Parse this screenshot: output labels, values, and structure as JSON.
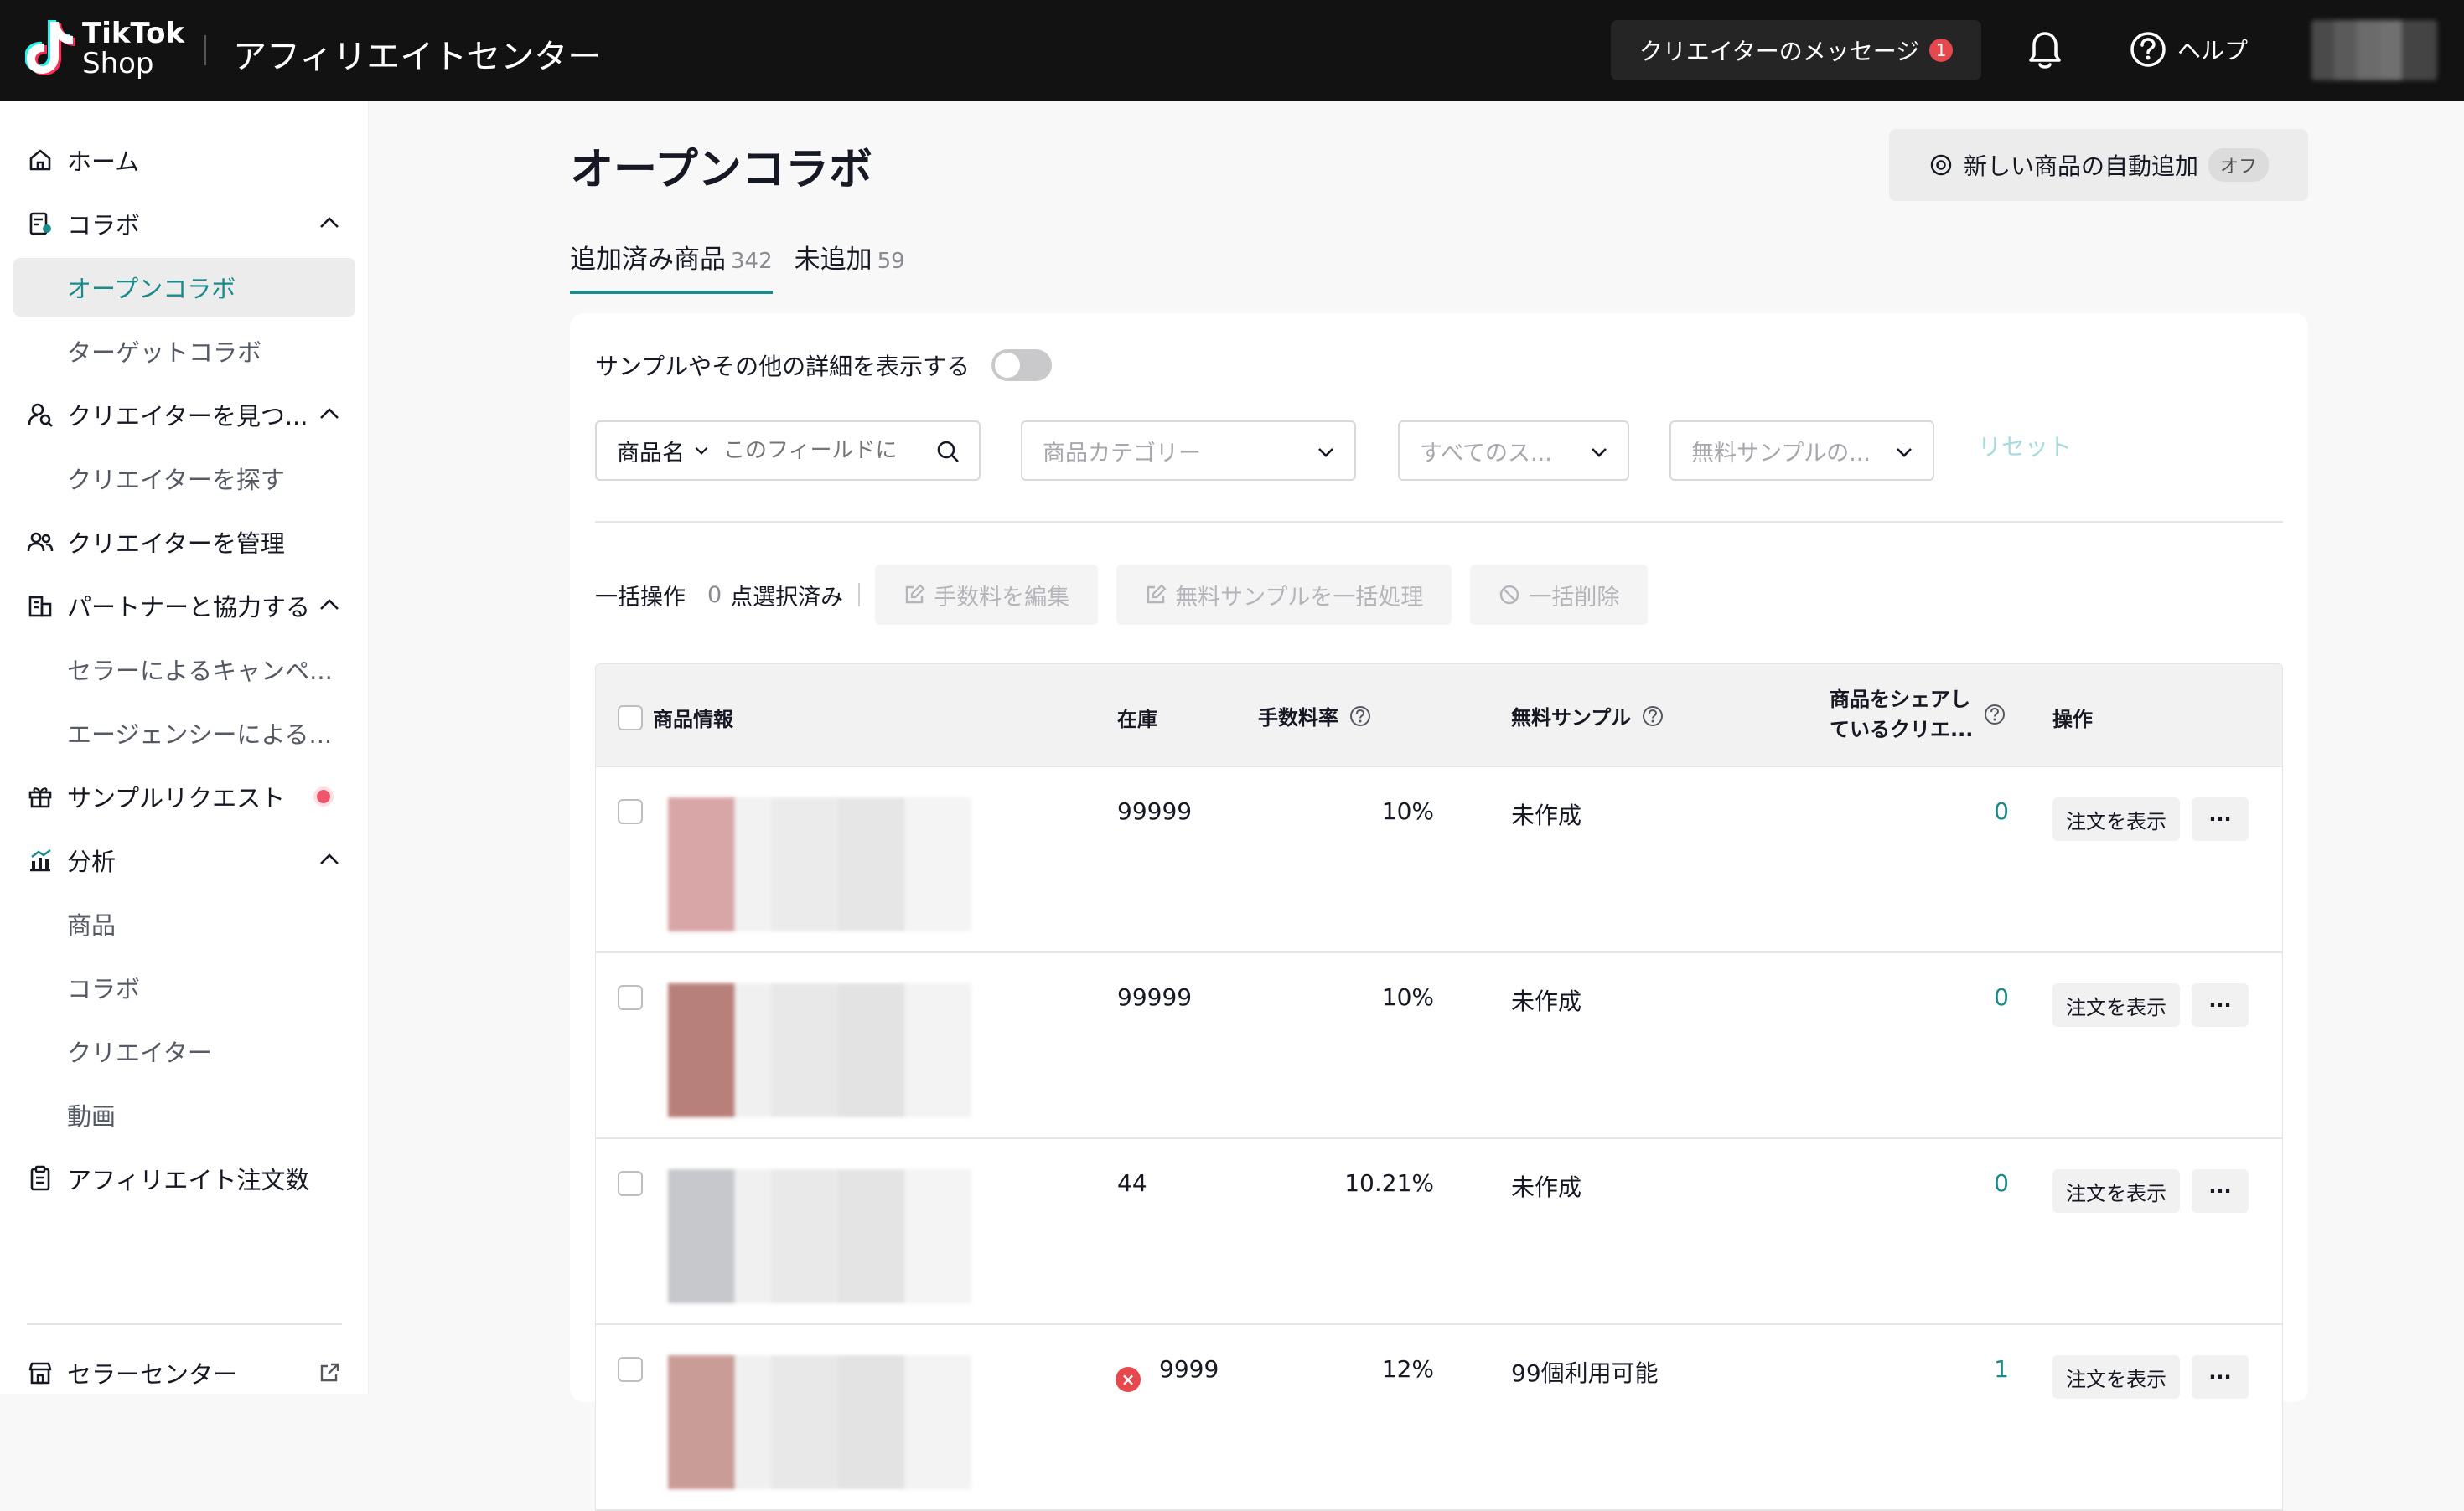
{
  "header": {
    "logo_line1": "TikTok",
    "logo_line2": "Shop",
    "app_title": "アフィリエイトセンター",
    "messages_label": "クリエイターのメッセージ",
    "messages_badge": "1",
    "help_label": "ヘルプ"
  },
  "sidebar": {
    "items": [
      {
        "label": "ホーム",
        "icon": "home-icon"
      },
      {
        "label": "コラボ",
        "icon": "collab-icon"
      },
      {
        "label": "オープンコラボ"
      },
      {
        "label": "ターゲットコラボ"
      },
      {
        "label": "クリエイターを見つ...",
        "icon": "find-creator-icon"
      },
      {
        "label": "クリエイターを探す"
      },
      {
        "label": "クリエイターを管理",
        "icon": "manage-creators-icon"
      },
      {
        "label": "パートナーと協力する",
        "icon": "partner-icon"
      },
      {
        "label": "セラーによるキャンペ..."
      },
      {
        "label": "エージェンシーによる..."
      },
      {
        "label": "サンプルリクエスト",
        "icon": "gift-icon"
      },
      {
        "label": "分析",
        "icon": "analytics-icon"
      },
      {
        "label": "商品"
      },
      {
        "label": "コラボ"
      },
      {
        "label": "クリエイター"
      },
      {
        "label": "動画"
      },
      {
        "label": "アフィリエイト注文数",
        "icon": "clipboard-icon"
      },
      {
        "label": "セラーセンター",
        "icon": "store-icon"
      }
    ]
  },
  "main": {
    "title": "オープンコラボ",
    "auto_add_label": "新しい商品の自動追加",
    "auto_add_state": "オフ",
    "tabs": [
      {
        "label": "追加済み商品",
        "count": "342"
      },
      {
        "label": "未追加",
        "count": "59"
      }
    ],
    "toggle_label": "サンプルやその他の詳細を表示する",
    "filters": {
      "name_select": "商品名",
      "search_placeholder": "このフィールドに",
      "category": "商品カテゴリー",
      "status": "すべてのス...",
      "sample": "無料サンプルの...",
      "reset": "リセット"
    },
    "bulk": {
      "label": "一括操作",
      "count": "0",
      "selected_label": "点選択済み",
      "edit_commission": "手数料を編集",
      "bulk_sample": "無料サンプルを一括処理",
      "bulk_delete": "一括削除"
    },
    "table": {
      "headers": {
        "product": "商品情報",
        "stock": "在庫",
        "commission": "手数料率",
        "sample": "無料サンプル",
        "share_l1": "商品をシェアし",
        "share_l2": "ているクリエ...",
        "action": "操作"
      },
      "rows": [
        {
          "stock": "99999",
          "commission": "10%",
          "sample": "未作成",
          "share": "0",
          "view": "注文を表示",
          "more": "···"
        },
        {
          "stock": "99999",
          "commission": "10%",
          "sample": "未作成",
          "share": "0",
          "view": "注文を表示",
          "more": "···"
        },
        {
          "stock": "44",
          "commission": "10.21%",
          "sample": "未作成",
          "share": "0",
          "view": "注文を表示",
          "more": "···"
        },
        {
          "stock": "9999",
          "commission": "12%",
          "sample": "99個利用可能",
          "share": "1",
          "view": "注文を表示",
          "more": "···"
        }
      ]
    }
  },
  "colors": {
    "accent": "#1a8a8a",
    "topbar": "#121212",
    "badge": "#e5484d"
  }
}
